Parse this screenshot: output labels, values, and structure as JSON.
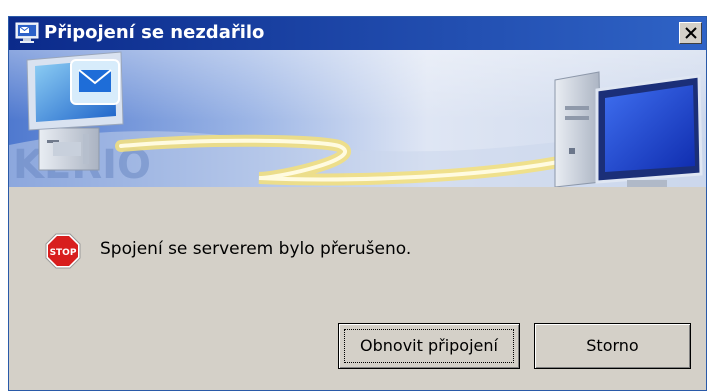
{
  "dialog": {
    "title": "Připojení se nezdařilo",
    "message": "Spojení se serverem bylo přerušeno.",
    "buttons": {
      "reconnect": "Obnovit připojení",
      "cancel": "Storno"
    },
    "icons": {
      "title": "network-computer-icon",
      "close": "close-icon",
      "message": "stop-sign-icon"
    },
    "stop_icon_text": "STOP",
    "banner_watermark": "KERIO"
  },
  "colors": {
    "titlebar_start": "#0b2a8a",
    "titlebar_end": "#2f63c6",
    "dialog_background": "#d4d0c8",
    "stop_red": "#d81e1e"
  }
}
